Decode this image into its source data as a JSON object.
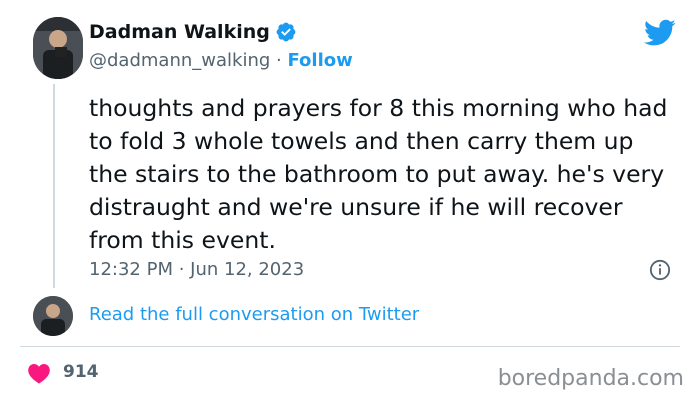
{
  "tweet": {
    "display_name": "Dadman Walking",
    "handle": "@dadmann_walking",
    "separator": "·",
    "follow_label": "Follow",
    "text": "thoughts and prayers for 8 this morning who had to fold 3 whole towels and then carry them up the stairs to the bathroom to put away. he's very distraught and we're unsure if he will recover from this event.",
    "timestamp": "12:32 PM · Jun 12, 2023",
    "read_more_label": "Read the full conversation on Twitter",
    "like_count": "914"
  },
  "icons": {
    "verified": "verified-badge-icon",
    "twitter": "twitter-bird-icon",
    "info": "info-icon",
    "like": "heart-icon"
  },
  "colors": {
    "accent": "#1d9bf0",
    "like": "#f91880",
    "text": "#0f1419",
    "muted": "#536471"
  },
  "watermark": "boredpanda.com"
}
